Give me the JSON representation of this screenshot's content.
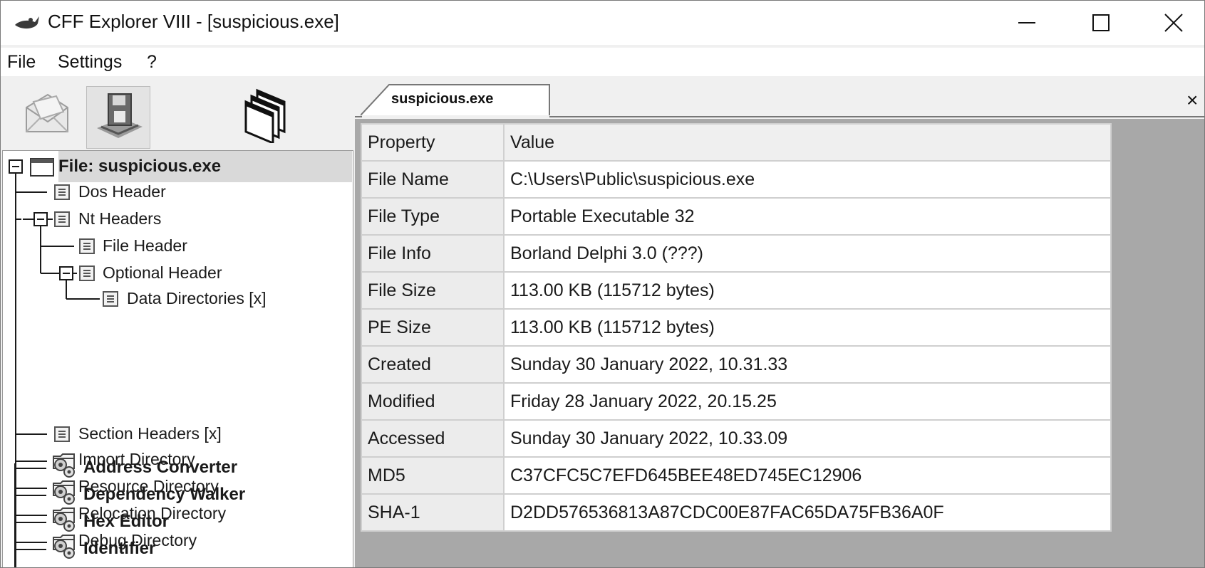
{
  "window": {
    "title": "CFF Explorer VIII - [suspicious.exe]",
    "icons": {
      "app": "cff-explorer-icon",
      "minimize": "minimize-icon",
      "maximize": "maximize-icon",
      "close": "close-icon"
    }
  },
  "menu": {
    "items": [
      "File",
      "Settings",
      "?"
    ]
  },
  "toolbar": {
    "buttons": [
      "open-file-icon",
      "save-file-icon",
      "windows-icon"
    ]
  },
  "tree": {
    "items": [
      {
        "label": "File: suspicious.exe",
        "icon": "window-icon",
        "bold": true,
        "selected": true,
        "expandable": true
      },
      {
        "label": "Dos Header",
        "icon": "page-icon",
        "bold": false
      },
      {
        "label": "Nt Headers",
        "icon": "page-icon",
        "bold": false,
        "expandable": true
      },
      {
        "label": "File Header",
        "icon": "page-icon",
        "bold": false
      },
      {
        "label": "Optional Header",
        "icon": "page-icon",
        "bold": false,
        "expandable": true
      },
      {
        "label": "Data Directories [x]",
        "icon": "page-icon",
        "bold": false
      },
      {
        "label": "Section Headers [x]",
        "icon": "page-icon",
        "bold": false
      },
      {
        "label": "Import Directory",
        "icon": "folder-icon",
        "bold": false
      },
      {
        "label": "Resource Directory",
        "icon": "folder-icon",
        "bold": false
      },
      {
        "label": "Relocation Directory",
        "icon": "folder-icon",
        "bold": false
      },
      {
        "label": "Debug Directory",
        "icon": "folder-icon",
        "bold": false
      },
      {
        "label": "Address Converter",
        "icon": "gears-icon",
        "bold": true
      },
      {
        "label": "Dependency Walker",
        "icon": "gears-icon",
        "bold": true
      },
      {
        "label": "Hex Editor",
        "icon": "gears-icon",
        "bold": true
      },
      {
        "label": "Identifier",
        "icon": "gears-icon",
        "bold": true
      }
    ]
  },
  "tabs": [
    {
      "label": "suspicious.exe",
      "active": true
    }
  ],
  "tab_close_label": "×",
  "properties": {
    "headers": [
      "Property",
      "Value"
    ],
    "rows": [
      [
        "File Name",
        "C:\\Users\\Public\\suspicious.exe"
      ],
      [
        "File Type",
        "Portable Executable 32"
      ],
      [
        "File Info",
        "Borland Delphi 3.0 (???)"
      ],
      [
        "File Size",
        "113.00 KB (115712 bytes)"
      ],
      [
        "PE Size",
        "113.00 KB (115712 bytes)"
      ],
      [
        "Created",
        "Sunday 30 January 2022, 10.31.33"
      ],
      [
        "Modified",
        "Friday 28 January 2022, 20.15.25"
      ],
      [
        "Accessed",
        "Sunday 30 January 2022, 10.33.09"
      ],
      [
        "MD5",
        "C37CFC5C7EFD645BEE48ED745EC12906"
      ],
      [
        "SHA-1",
        "D2DD576536813A87CDC00E87FAC65DA75FB36A0F"
      ]
    ]
  }
}
